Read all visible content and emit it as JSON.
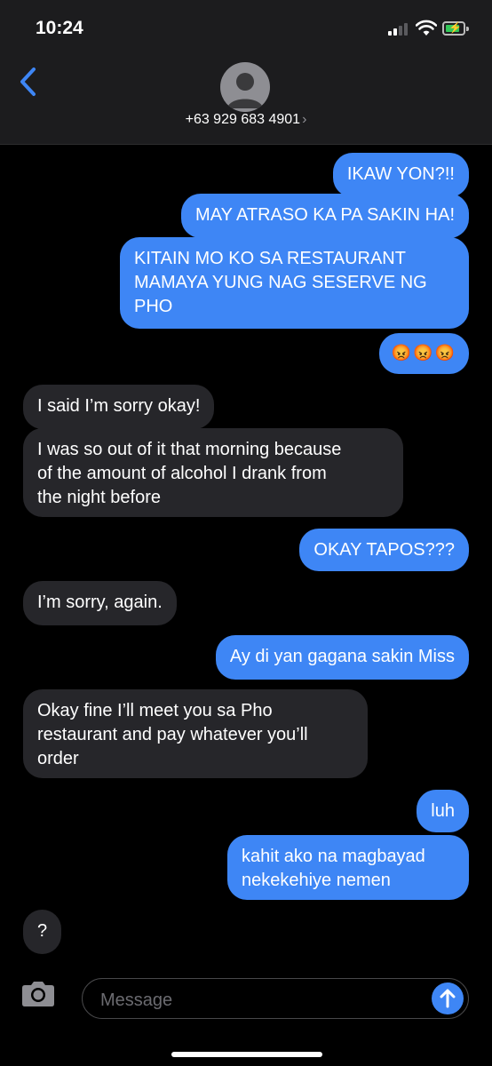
{
  "status_bar": {
    "time": "10:24"
  },
  "header": {
    "contact": "+63 929 683 4901",
    "contact_chevron": "›"
  },
  "messages": [
    {
      "from": "me",
      "text": "IKAW YON?!!"
    },
    {
      "from": "me",
      "text": "MAY ATRASO KA PA SAKIN HA!"
    },
    {
      "from": "me",
      "text": "KITAIN MO KO SA RESTAURANT\nMAMAYA YUNG NAG SESERVE NG\nPHO"
    },
    {
      "from": "me",
      "text": "😡😡😡"
    },
    {
      "from": "them",
      "text": "I said I’m sorry okay!"
    },
    {
      "from": "them",
      "text": "I was so out of it that morning because\nof the amount of alcohol I drank from\nthe night before"
    },
    {
      "from": "me",
      "text": "OKAY TAPOS???"
    },
    {
      "from": "them",
      "text": "I’m sorry, again."
    },
    {
      "from": "me",
      "text": "Ay di yan gagana sakin Miss"
    },
    {
      "from": "them",
      "text": "Okay fine I’ll meet you sa Pho\nrestaurant and pay whatever you’ll\norder"
    },
    {
      "from": "me",
      "text": "luh"
    },
    {
      "from": "me",
      "text": "kahit ako na magbayad\nnekekehiye nemen"
    },
    {
      "from": "them",
      "text": "?"
    }
  ],
  "compose": {
    "placeholder": "Message"
  },
  "icons": {
    "back": "chevron-left-icon",
    "avatar": "person-icon",
    "camera": "camera-icon",
    "send": "arrow-up-icon"
  },
  "colors": {
    "sent_bubble": "#3e86f5",
    "received_bubble": "#26262a",
    "accent": "#3e86f5"
  }
}
